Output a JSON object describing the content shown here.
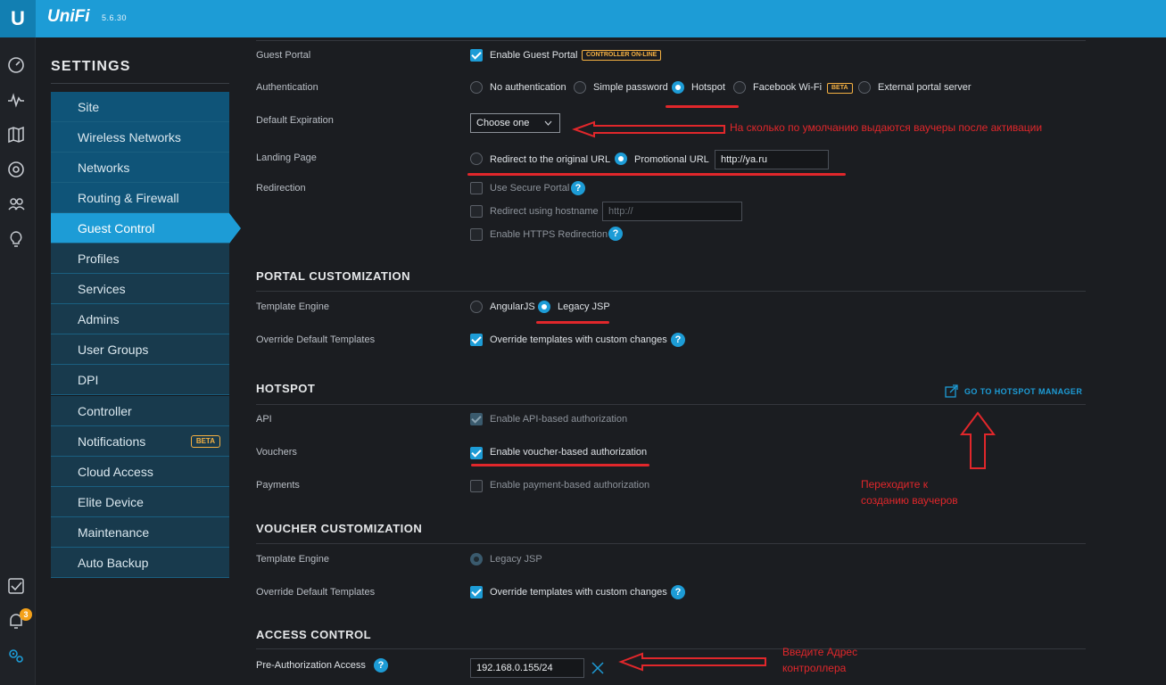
{
  "app": {
    "brand": "UniFi",
    "version": "5.6.30",
    "logo_letter": "U"
  },
  "rail": {
    "notification_count": "3"
  },
  "sidebar": {
    "title": "SETTINGS",
    "group1": [
      {
        "label": "Site"
      },
      {
        "label": "Wireless Networks"
      },
      {
        "label": "Networks"
      },
      {
        "label": "Routing & Firewall"
      },
      {
        "label": "Guest Control"
      },
      {
        "label": "Profiles"
      },
      {
        "label": "Services"
      },
      {
        "label": "Admins"
      },
      {
        "label": "User Groups"
      },
      {
        "label": "DPI"
      }
    ],
    "group2": [
      {
        "label": "Controller"
      },
      {
        "label": "Notifications",
        "badge": "BETA"
      },
      {
        "label": "Cloud Access"
      },
      {
        "label": "Elite Device"
      },
      {
        "label": "Maintenance"
      },
      {
        "label": "Auto Backup"
      }
    ],
    "active": "Guest Control"
  },
  "guest": {
    "portal_label": "Guest Portal",
    "portal_opt": "Enable Guest Portal",
    "portal_tag": "CONTROLLER ON-LINE",
    "auth_label": "Authentication",
    "auth_opts": [
      "No authentication",
      "Simple password",
      "Hotspot",
      "Facebook Wi-Fi",
      "External portal server"
    ],
    "auth_selected": "Hotspot",
    "fb_tag": "BETA",
    "expiry_label": "Default Expiration",
    "expiry_value": "Choose one",
    "landing_label": "Landing Page",
    "landing_opts": [
      "Redirect to the original URL",
      "Promotional URL"
    ],
    "landing_url": "http://ya.ru",
    "redir_label": "Redirection",
    "redir_opts": [
      "Use Secure Portal",
      "Redirect using hostname",
      "Enable HTTPS Redirection"
    ],
    "hostname_placeholder": "http://"
  },
  "portal": {
    "title": "PORTAL CUSTOMIZATION",
    "engine_label": "Template Engine",
    "engine_opts": [
      "AngularJS",
      "Legacy JSP"
    ],
    "override_label": "Override Default Templates",
    "override_opt": "Override templates with custom changes"
  },
  "hotspot": {
    "title": "HOTSPOT",
    "manager_link": "GO TO HOTSPOT MANAGER",
    "api_label": "API",
    "api_opt": "Enable API-based authorization",
    "vouchers_label": "Vouchers",
    "vouchers_opt": "Enable voucher-based authorization",
    "payments_label": "Payments",
    "payments_opt": "Enable payment-based authorization"
  },
  "voucher": {
    "title": "VOUCHER CUSTOMIZATION",
    "engine_label": "Template Engine",
    "engine_opt": "Legacy JSP",
    "override_label": "Override Default Templates",
    "override_opt": "Override templates with custom changes"
  },
  "access": {
    "title": "ACCESS CONTROL",
    "preauth_label": "Pre-Authorization Access",
    "preauth_value": "192.168.0.155/24"
  },
  "annotations": {
    "expiry_note": "На сколько по умолчанию выдаются ваучеры после активации",
    "hotspot_note_1": "Переходите к",
    "hotspot_note_2": "созданию ваучеров",
    "access_note_1": "Введите Адрес",
    "access_note_2": "контроллера"
  },
  "colors": {
    "accent": "#1d9cd6",
    "annotation": "#e1272b",
    "badge": "#f4b042"
  }
}
